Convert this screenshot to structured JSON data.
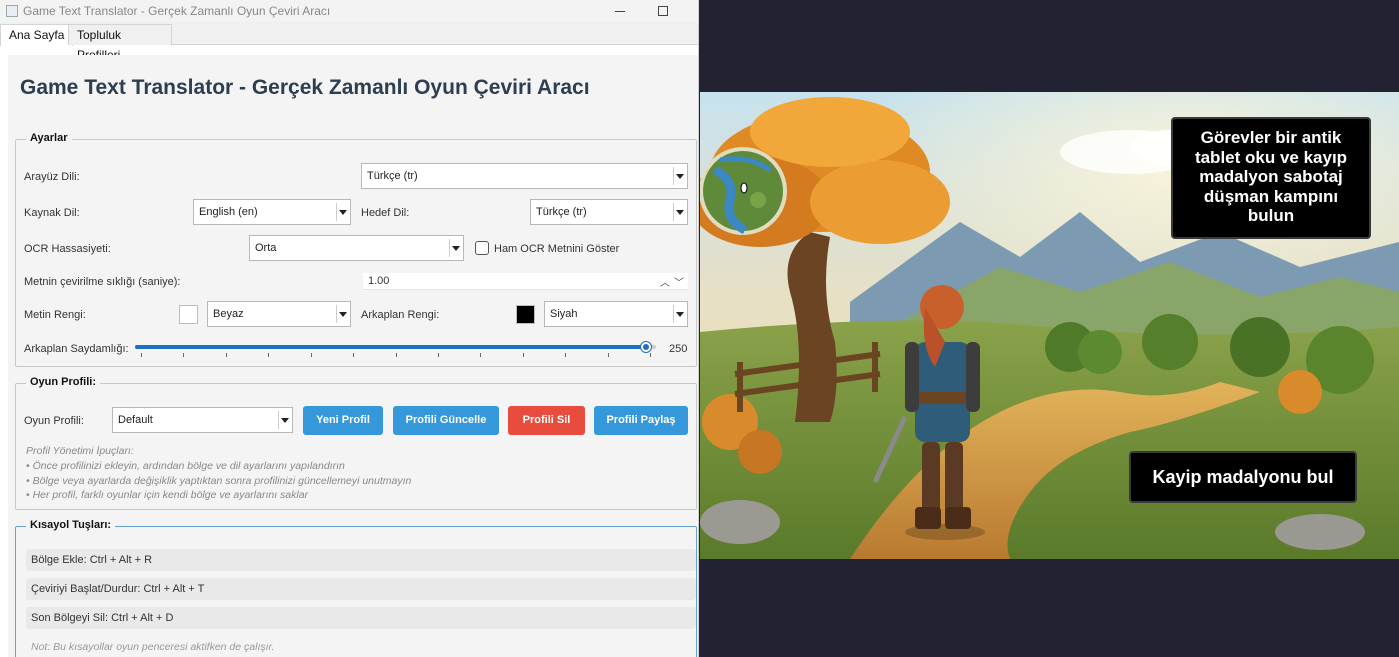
{
  "window": {
    "title": "Game Text Translator - Gerçek Zamanlı Oyun Çeviri Aracı"
  },
  "tabs": [
    {
      "label": "Ana Sayfa"
    },
    {
      "label": "Topluluk Profilleri"
    }
  ],
  "page": {
    "title": "Game Text Translator - Gerçek Zamanlı Oyun Çeviri Aracı"
  },
  "settings": {
    "group_label": "Ayarlar",
    "ui_language_label": "Arayüz Dili:",
    "ui_language_value": "Türkçe (tr)",
    "source_language_label": "Kaynak Dil:",
    "source_language_value": "English (en)",
    "target_language_label": "Hedef Dil:",
    "target_language_value": "Türkçe (tr)",
    "ocr_sensitivity_label": "OCR Hassasiyeti:",
    "ocr_sensitivity_value": "Orta",
    "show_raw_ocr_label": "Ham OCR Metnini Göster",
    "show_raw_ocr_checked": false,
    "translate_freq_label": "Metnin çevirilme sıklığı (saniye):",
    "translate_freq_value": "1.00",
    "text_color_label": "Metin Rengi:",
    "text_color_value": "Beyaz",
    "text_color_hex": "#ffffff",
    "bg_color_label": "Arkaplan Rengi:",
    "bg_color_value": "Siyah",
    "bg_color_hex": "#000000",
    "bg_opacity_label": "Arkaplan Saydamlığı:",
    "bg_opacity_value": "250",
    "bg_opacity_max": 255
  },
  "profile": {
    "group_label": "Oyun Profili:",
    "profile_label": "Oyun Profili:",
    "profile_value": "Default",
    "new_button": "Yeni Profil",
    "update_button": "Profili Güncelle",
    "delete_button": "Profili Sil",
    "share_button": "Profili Paylaş",
    "tips": [
      "Profil Yönetimi İpuçları:",
      "• Önce profilinizi ekleyin, ardından bölge ve dil ayarlarını yapılandırın",
      "• Bölge veya ayarlarda değişiklik yaptıktan sonra profilinizi güncellemeyi unutmayın",
      "• Her profil, farklı oyunlar için kendi bölge ve ayarlarını saklar"
    ]
  },
  "shortcuts": {
    "group_label": "Kısayol Tuşları:",
    "items": [
      "Bölge Ekle: Ctrl + Alt + R",
      "Çeviriyi Başlat/Durdur: Ctrl + Alt + T",
      "Son Bölgeyi Sil: Ctrl + Alt + D"
    ],
    "note": "Not: Bu kısayollar oyun penceresi aktifken de çalışır."
  },
  "game": {
    "overlay_1": "Görevler bir antik\ntablet oku ve kayıp\nmadalyon sabotaj\ndüşman kampını\nbulun",
    "overlay_2": "Kayip madalyonu bul"
  },
  "colors": {
    "primary_button": "#3498db",
    "danger_button": "#e74c3c",
    "slider": "#1f6fc5",
    "title_text": "#2c3e50"
  }
}
